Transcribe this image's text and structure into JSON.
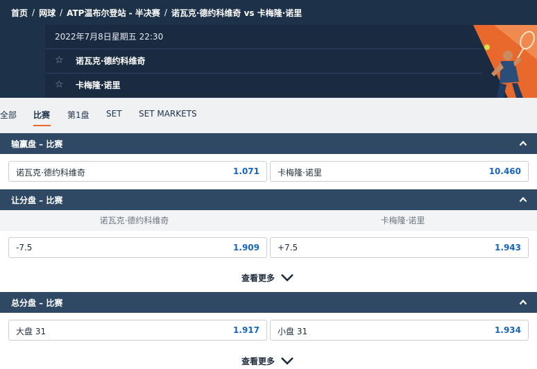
{
  "breadcrumb": [
    "首页",
    "网球",
    "ATP温布尔登站 - 半决赛",
    "诺瓦克·德约科维奇 vs 卡梅隆·诺里"
  ],
  "match": {
    "datetime": "2022年7月8日星期五 22:30",
    "player1": "诺瓦克·德约科维奇",
    "player2": "卡梅隆·诺里"
  },
  "tabs": [
    "全部",
    "比赛",
    "第1盘",
    "SET",
    "SET MARKETS"
  ],
  "active_tab": "比赛",
  "markets": {
    "moneyline": {
      "title": "输赢盘 – 比赛",
      "p1_label": "诺瓦克·德约科维奇",
      "p1_odds": "1.071",
      "p2_label": "卡梅隆·诺里",
      "p2_odds": "10.460"
    },
    "handicap": {
      "title": "让分盘 – 比赛",
      "col1": "诺瓦克·德约科维奇",
      "col2": "卡梅隆·诺里",
      "p1_label": "-7.5",
      "p1_odds": "1.909",
      "p2_label": "+7.5",
      "p2_odds": "1.943",
      "more": "查看更多"
    },
    "totals": {
      "title": "总分盘 – 比赛",
      "over_label": "大盘 31",
      "over_odds": "1.917",
      "under_label": "小盘 31",
      "under_odds": "1.934",
      "more": "查看更多"
    }
  },
  "colors": {
    "header": "#1d3149",
    "section_bar": "#2f4965",
    "accent": "#e8692b",
    "odds": "#1565c0"
  }
}
